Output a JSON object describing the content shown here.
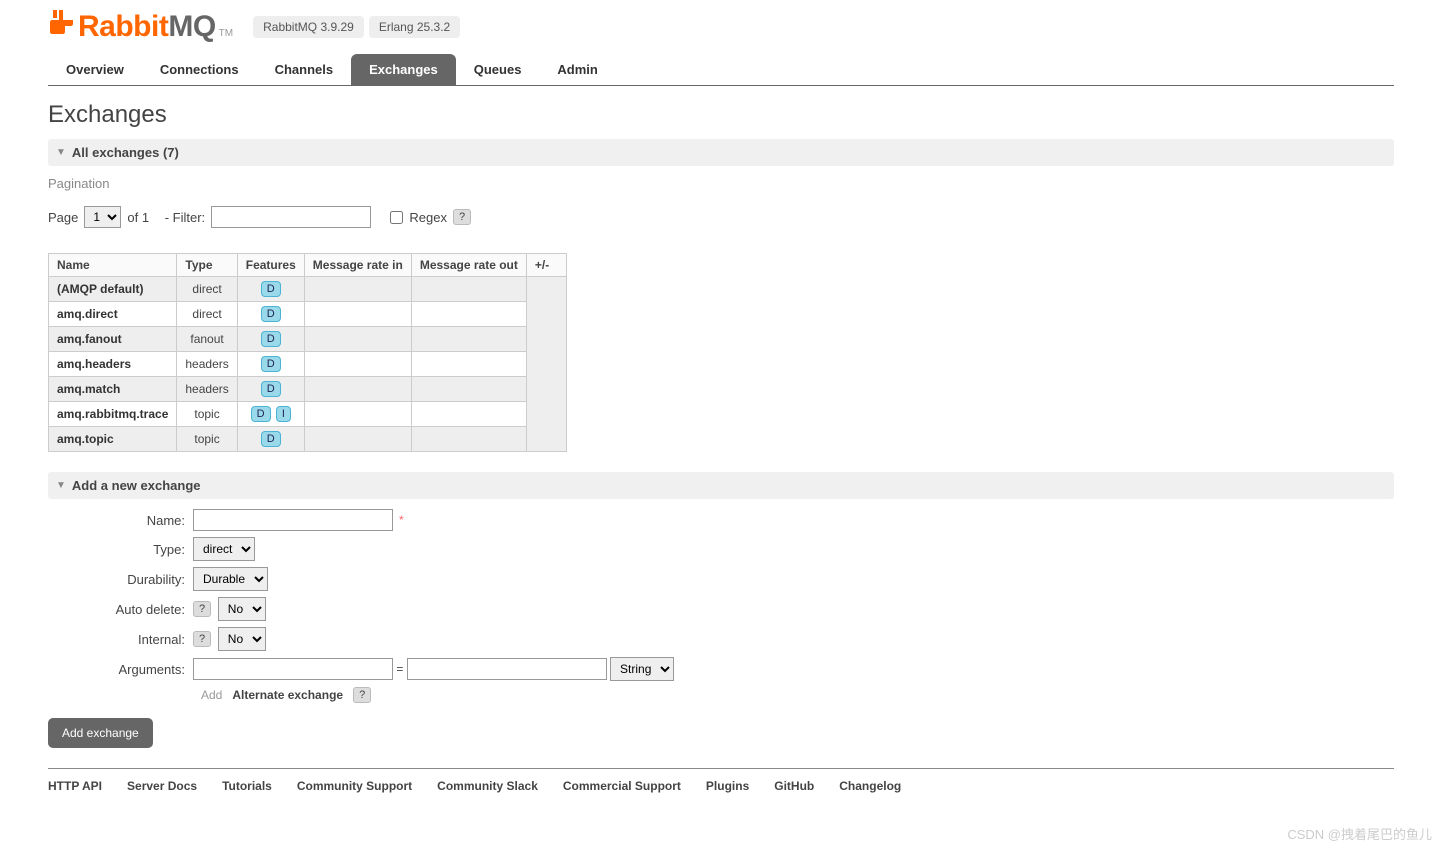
{
  "header": {
    "brand_prefix": "Rabbit",
    "brand_suffix": "MQ",
    "tm": "TM",
    "version": "RabbitMQ 3.9.29",
    "erlang": "Erlang 25.3.2"
  },
  "tabs": {
    "overview": "Overview",
    "connections": "Connections",
    "channels": "Channels",
    "exchanges": "Exchanges",
    "queues": "Queues",
    "admin": "Admin"
  },
  "page": {
    "title": "Exchanges",
    "all_header": "All exchanges (7)",
    "pagination_label": "Pagination",
    "page_label": "Page",
    "page_value": "1",
    "of_label": "of 1",
    "filter_label": "- Filter:",
    "regex_label": "Regex",
    "help": "?"
  },
  "table": {
    "cols": {
      "name": "Name",
      "type": "Type",
      "features": "Features",
      "rate_in": "Message rate in",
      "rate_out": "Message rate out",
      "plusminus": "+/-"
    },
    "rows": [
      {
        "name": "(AMQP default)",
        "type": "direct",
        "features": [
          "D"
        ],
        "alt": true
      },
      {
        "name": "amq.direct",
        "type": "direct",
        "features": [
          "D"
        ],
        "alt": false
      },
      {
        "name": "amq.fanout",
        "type": "fanout",
        "features": [
          "D"
        ],
        "alt": true
      },
      {
        "name": "amq.headers",
        "type": "headers",
        "features": [
          "D"
        ],
        "alt": false
      },
      {
        "name": "amq.match",
        "type": "headers",
        "features": [
          "D"
        ],
        "alt": true
      },
      {
        "name": "amq.rabbitmq.trace",
        "type": "topic",
        "features": [
          "D",
          "I"
        ],
        "alt": false
      },
      {
        "name": "amq.topic",
        "type": "topic",
        "features": [
          "D"
        ],
        "alt": true
      }
    ]
  },
  "form": {
    "header": "Add a new exchange",
    "name_label": "Name:",
    "type_label": "Type:",
    "type_value": "direct",
    "durability_label": "Durability:",
    "durability_value": "Durable",
    "autodelete_label": "Auto delete:",
    "autodelete_value": "No",
    "internal_label": "Internal:",
    "internal_value": "No",
    "arguments_label": "Arguments:",
    "arg_type_value": "String",
    "eq": "=",
    "add_label": "Add",
    "alternate_label": "Alternate exchange",
    "submit": "Add exchange",
    "req": "*",
    "help": "?"
  },
  "footer": {
    "http_api": "HTTP API",
    "server_docs": "Server Docs",
    "tutorials": "Tutorials",
    "community_support": "Community Support",
    "community_slack": "Community Slack",
    "commercial_support": "Commercial Support",
    "plugins": "Plugins",
    "github": "GitHub",
    "changelog": "Changelog"
  },
  "watermark": "CSDN @拽着尾巴的鱼儿"
}
